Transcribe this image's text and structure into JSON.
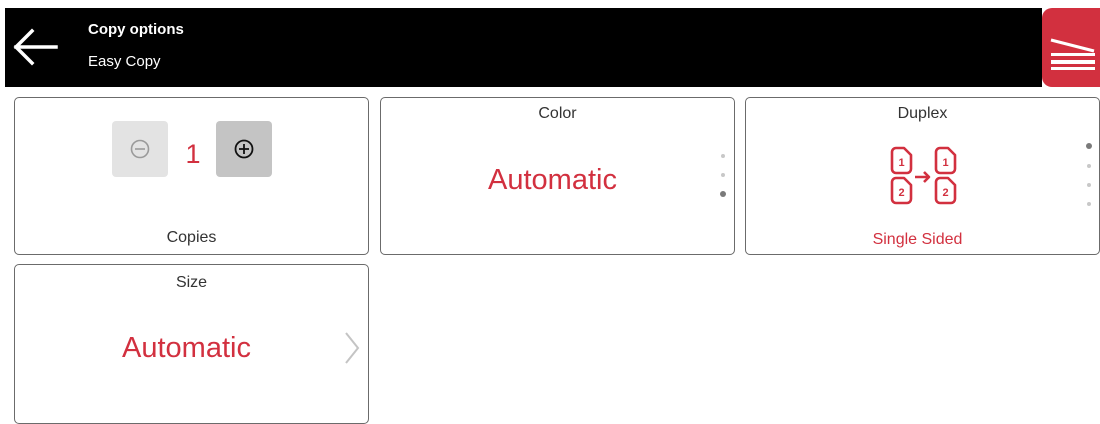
{
  "header": {
    "title": "Copy options",
    "subtitle": "Easy Copy",
    "back_icon": "arrow-left-icon",
    "scan_icon": "scanner-icon",
    "accent_color": "#d2303f"
  },
  "tiles": {
    "copies": {
      "label": "Copies",
      "value": "1",
      "minus_icon": "minus-circle-icon",
      "plus_icon": "plus-circle-icon"
    },
    "color": {
      "label": "Color",
      "value": "Automatic",
      "option_count": 3,
      "selected_index": 2
    },
    "duplex": {
      "label": "Duplex",
      "value": "Single Sided",
      "icon": "duplex-pages-icon",
      "icon_page_numbers": [
        "1",
        "1",
        "2",
        "2"
      ],
      "option_count": 4,
      "selected_index": 0
    },
    "size": {
      "label": "Size",
      "value": "Automatic",
      "chevron_icon": "chevron-right-icon"
    }
  }
}
